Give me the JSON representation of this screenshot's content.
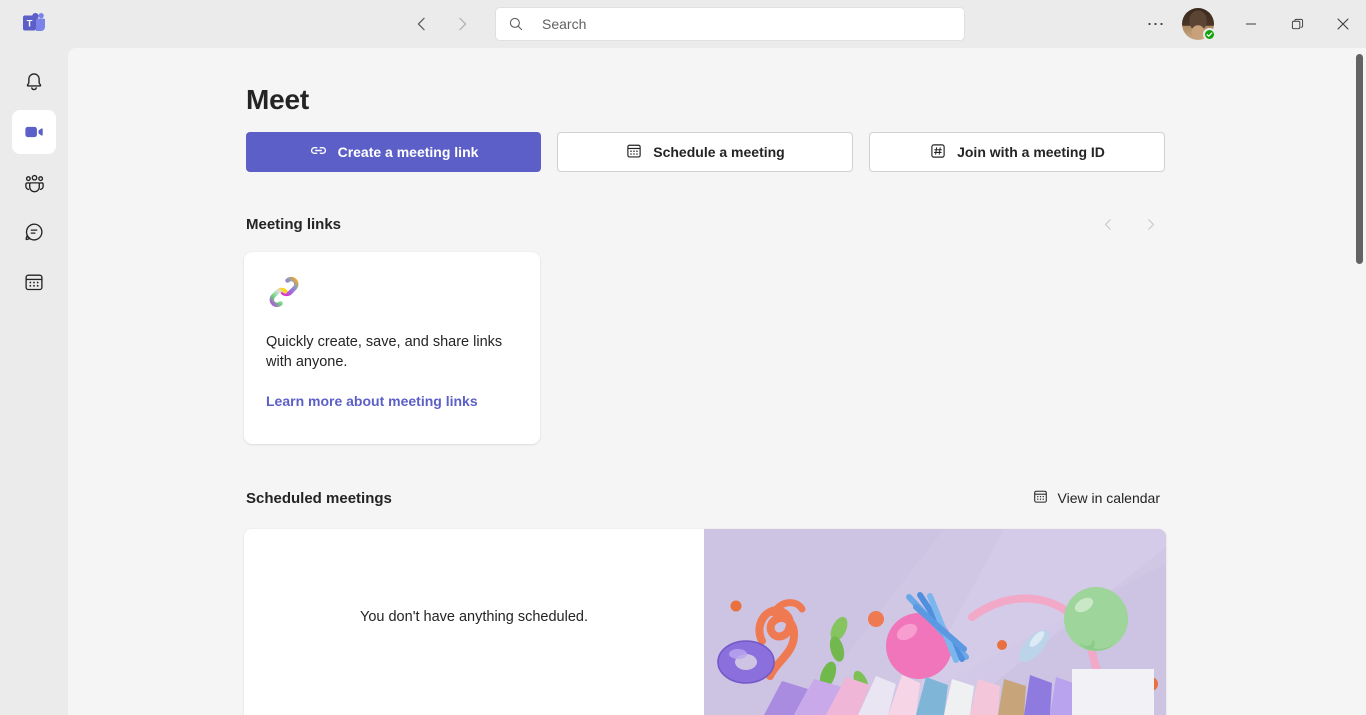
{
  "window": {
    "app_name": "Microsoft Teams",
    "minimize_label": "Minimize",
    "maximize_label": "Restore",
    "close_label": "Close",
    "more_label": "Settings and more"
  },
  "titlebar": {
    "back_label": "Back",
    "forward_label": "Forward",
    "search": {
      "placeholder": "Search",
      "value": ""
    },
    "avatar": {
      "presence": "Available",
      "presence_color": "#13a10e"
    }
  },
  "rail": {
    "items": [
      {
        "id": "activity",
        "label": "Activity",
        "icon": "bell-icon",
        "active": false
      },
      {
        "id": "meet",
        "label": "Meet",
        "icon": "video-camera-icon",
        "active": true
      },
      {
        "id": "communities",
        "label": "Communities",
        "icon": "people-icon",
        "active": false
      },
      {
        "id": "chat",
        "label": "Chat",
        "icon": "chat-bubble-icon",
        "active": false
      },
      {
        "id": "calendar",
        "label": "Calendar",
        "icon": "calendar-icon",
        "active": false
      }
    ]
  },
  "main": {
    "title": "Meet",
    "actions": [
      {
        "id": "create-meeting-link",
        "label": "Create a meeting link",
        "icon": "link-icon",
        "style": "primary"
      },
      {
        "id": "schedule-meeting",
        "label": "Schedule a meeting",
        "icon": "calendar-icon",
        "style": "secondary"
      },
      {
        "id": "join-meeting-id",
        "label": "Join with a meeting ID",
        "icon": "hash-icon",
        "style": "secondary"
      }
    ],
    "meeting_links": {
      "section_title": "Meeting links",
      "prev_label": "Previous",
      "next_label": "Next",
      "card": {
        "icon": "chain-link-icon",
        "description": "Quickly create, save, and share links with anyone.",
        "link_label": "Learn more about meeting links"
      }
    },
    "scheduled_meetings": {
      "section_title": "Scheduled meetings",
      "view_in_calendar_label": "View in calendar",
      "view_in_calendar_icon": "calendar-icon",
      "empty_message": "You don't have anything scheduled."
    }
  },
  "colors": {
    "brand_purple": "#5b5fc7",
    "link_purple": "#5b5fc7",
    "presence_green": "#13a10e",
    "rail_bg": "#ebebeb",
    "content_bg": "#f5f5f5",
    "card_bg": "#ffffff",
    "art_bg": "#cdc3e3"
  }
}
